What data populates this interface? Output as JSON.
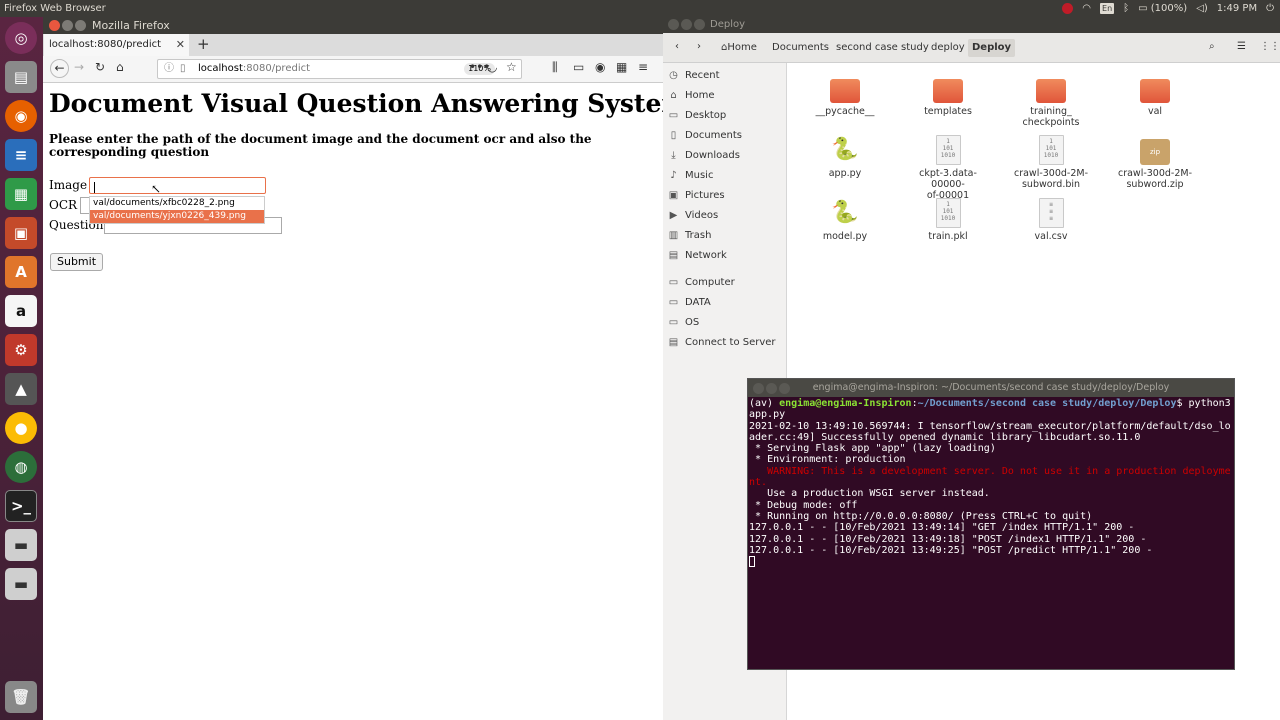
{
  "topbar": {
    "title": "Firefox Web Browser",
    "lang": "En",
    "battery": "(100%)",
    "time": "1:49 PM"
  },
  "launcher": {
    "icons": [
      "ubuntu-dash-icon",
      "files-icon",
      "firefox-icon",
      "writer-icon",
      "calc-icon",
      "impress-icon",
      "software-center-icon",
      "amazon-icon",
      "settings-icon",
      "lock-icon",
      "chrome-icon",
      "globe-icon",
      "terminal-icon",
      "disk-icon",
      "disk-icon-2",
      "trash-icon"
    ]
  },
  "firefox": {
    "window_title": "Mozilla Firefox",
    "tab_label": "localhost:8080/predict",
    "url_host": "localhost",
    "url_rest": ":8080/predict",
    "zoom": "110%",
    "page": {
      "heading": "Document Visual Question Answering System",
      "subheading": "Please enter the path of the document image and the document ocr and also the corresponding question",
      "image_label": "Image",
      "ocr_label": "OCR",
      "question_label": "Question",
      "submit_label": "Submit",
      "suggestions": [
        "val/documents/xfbc0228_2.png",
        "val/documents/yjxn0226_439.png"
      ]
    }
  },
  "files": {
    "window_title": "Deploy",
    "breadcrumbs": [
      "Home",
      "Documents",
      "second case study",
      "deploy",
      "Deploy"
    ],
    "sidebar": [
      "Recent",
      "Home",
      "Desktop",
      "Documents",
      "Downloads",
      "Music",
      "Pictures",
      "Videos",
      "Trash",
      "Network",
      "Computer",
      "DATA",
      "OS",
      "Connect to Server"
    ],
    "items": [
      {
        "name": "__pycache__",
        "type": "folder"
      },
      {
        "name": "templates",
        "type": "folder"
      },
      {
        "name": "training_\ncheckpoints",
        "type": "folder"
      },
      {
        "name": "val",
        "type": "folder"
      },
      {
        "name": "app.py",
        "type": "python"
      },
      {
        "name": "ckpt-3.data-00000-\nof-00001",
        "type": "binary"
      },
      {
        "name": "crawl-300d-2M-\nsubword.bin",
        "type": "binary"
      },
      {
        "name": "crawl-300d-2M-\nsubword.zip",
        "type": "zip"
      },
      {
        "name": "model.py",
        "type": "python"
      },
      {
        "name": "train.pkl",
        "type": "binary"
      },
      {
        "name": "val.csv",
        "type": "text"
      }
    ]
  },
  "terminal": {
    "title": "engima@engima-Inspiron: ~/Documents/second case study/deploy/Deploy",
    "prompt_env": "(av) ",
    "prompt_user": "engima@engima-Inspiron",
    "prompt_path": "~/Documents/second case study/deploy/Deploy",
    "command": "$ python3 app.py",
    "lines": [
      "2021-02-10 13:49:10.569744: I tensorflow/stream_executor/platform/default/dso_loader.cc:49] Successfully opened dynamic library libcudart.so.11.0",
      " * Serving Flask app \"app\" (lazy loading)",
      " * Environment: production"
    ],
    "warning": "   WARNING: This is a development server. Do not use it in a production deployment.",
    "lines2": [
      "   Use a production WSGI server instead.",
      " * Debug mode: off",
      " * Running on http://0.0.0.0:8080/ (Press CTRL+C to quit)",
      "127.0.0.1 - - [10/Feb/2021 13:49:14] \"GET /index HTTP/1.1\" 200 -",
      "127.0.0.1 - - [10/Feb/2021 13:49:18] \"POST /index1 HTTP/1.1\" 200 -",
      "127.0.0.1 - - [10/Feb/2021 13:49:25] \"POST /predict HTTP/1.1\" 200 -"
    ]
  }
}
